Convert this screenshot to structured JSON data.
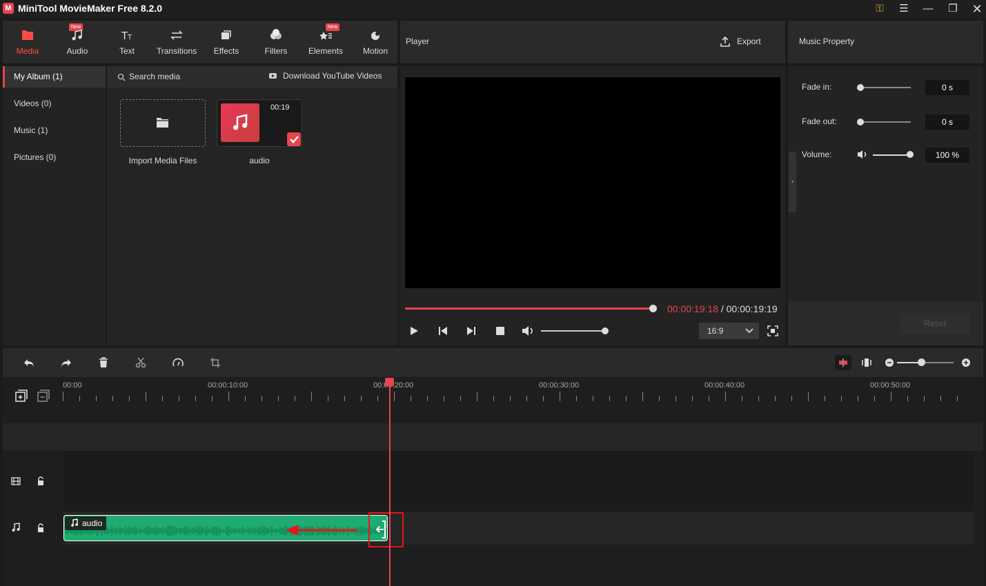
{
  "window": {
    "title": "MiniTool MovieMaker Free 8.2.0",
    "logo_text": "M"
  },
  "toolbar": {
    "tools": [
      {
        "label": "Media",
        "active": true
      },
      {
        "label": "Audio",
        "badge": "New"
      },
      {
        "label": "Text"
      },
      {
        "label": "Transitions"
      },
      {
        "label": "Effects"
      },
      {
        "label": "Filters"
      },
      {
        "label": "Elements",
        "badge": "New"
      },
      {
        "label": "Motion"
      }
    ]
  },
  "library": {
    "items": [
      "My Album (1)",
      "Videos (0)",
      "Music (1)",
      "Pictures (0)"
    ],
    "search_placeholder": "Search media",
    "download_label": "Download YouTube Videos",
    "import_label": "Import Media Files",
    "audio_label": "audio",
    "audio_duration": "00:19"
  },
  "player": {
    "title": "Player",
    "export_label": "Export",
    "current_time": "00:00:19:18",
    "separator": " / ",
    "total_time": "00:00:19:19",
    "progress": 1.0,
    "volume": 1.0,
    "aspect_ratio": "16:9"
  },
  "property": {
    "title": "Music Property",
    "fade_in_label": "Fade in:",
    "fade_in_value": "0 s",
    "fade_out_label": "Fade out:",
    "fade_out_value": "0 s",
    "volume_label": "Volume:",
    "volume_value": "100 %",
    "reset_label": "Reset"
  },
  "timeline": {
    "ruler_labels": [
      "00:00",
      "00:00:10:00",
      "00:00:20:00",
      "00:00:30:00",
      "00:00:40:00",
      "00:00:50:00"
    ],
    "clip_label": "audio",
    "colors": {
      "clip": "#1fab72",
      "playhead": "#e8454d",
      "accent": "#e8454d"
    }
  }
}
